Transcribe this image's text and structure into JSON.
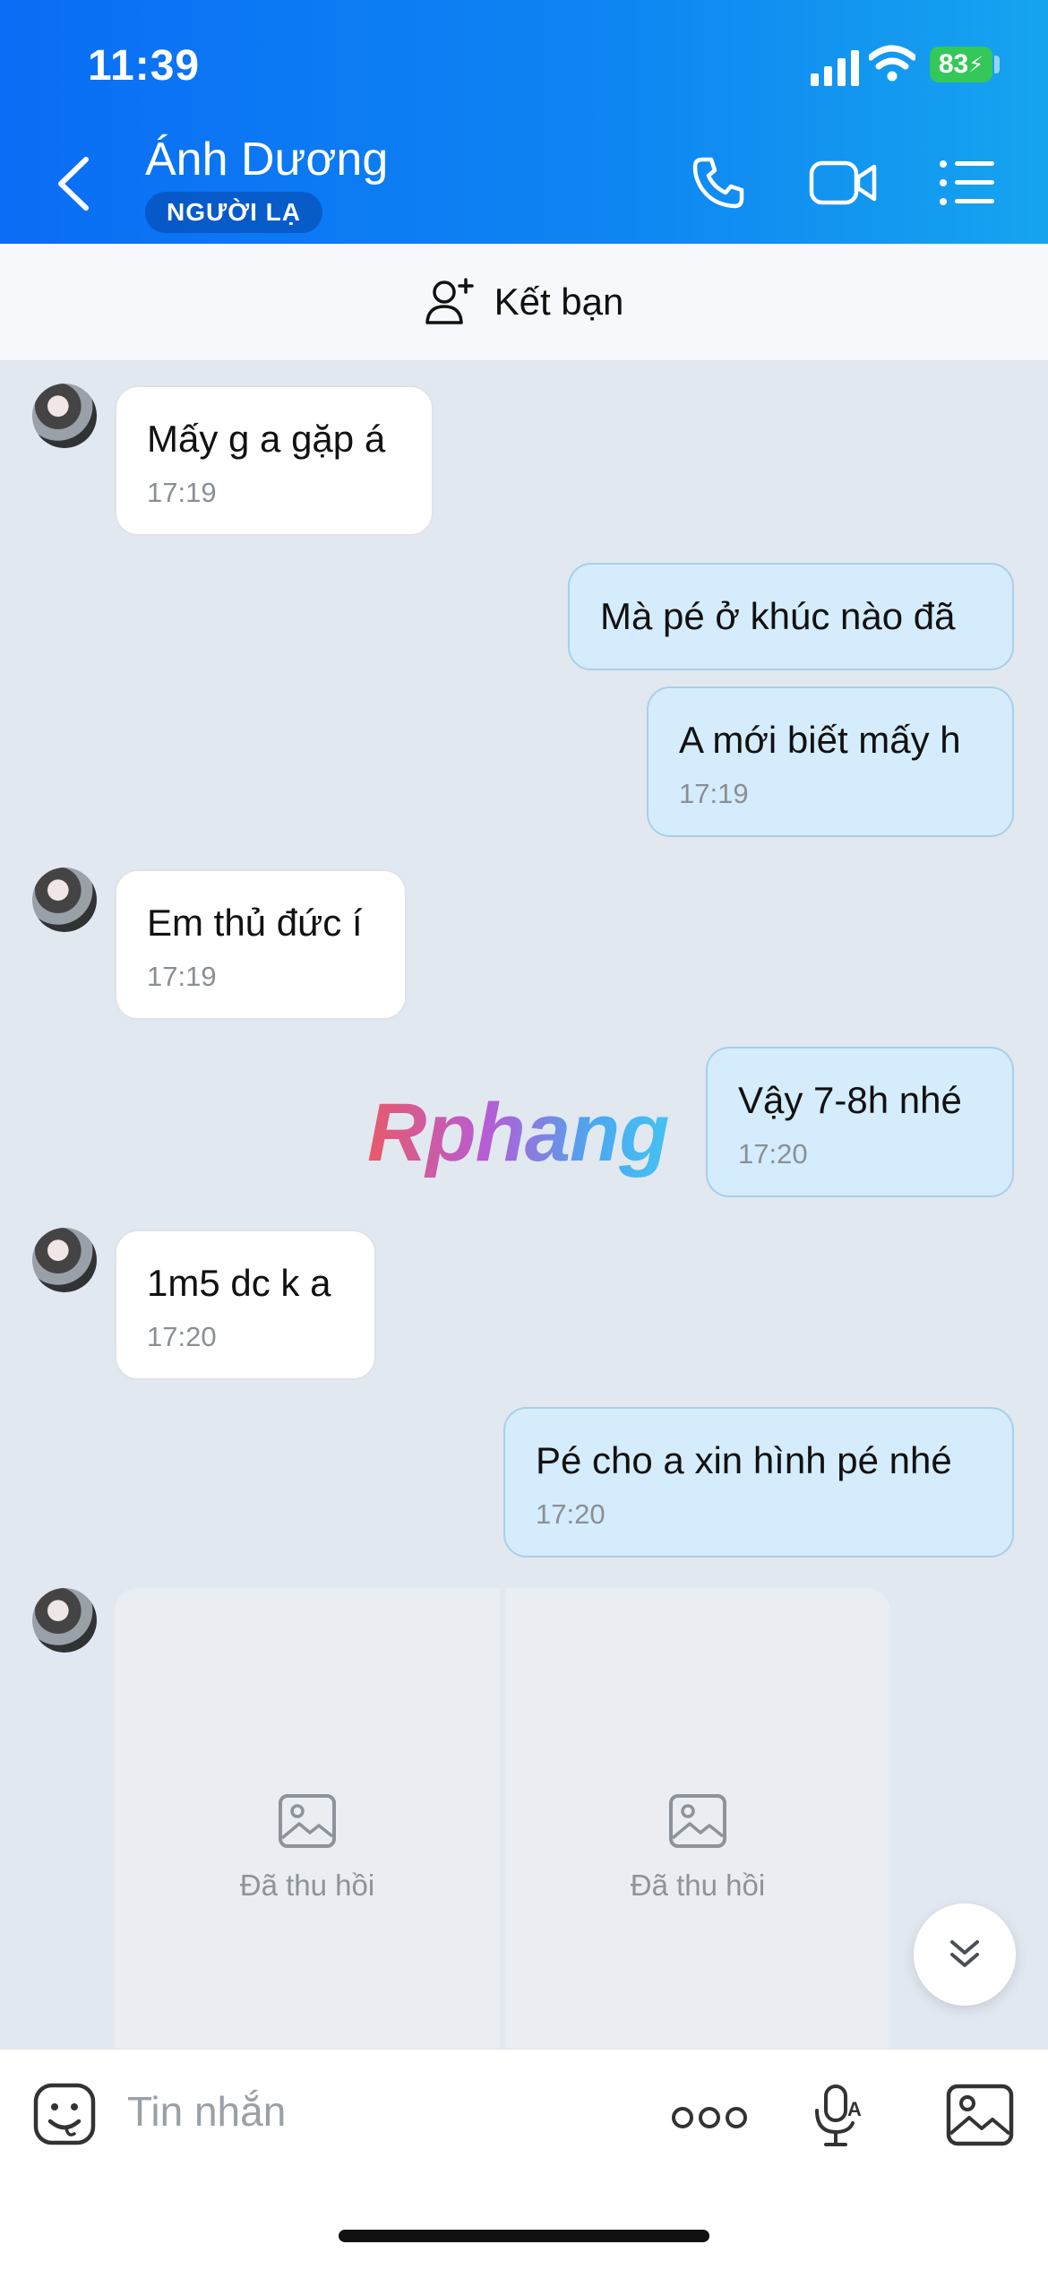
{
  "status_bar": {
    "time": "11:39",
    "battery": "83"
  },
  "header": {
    "contact_name": "Ánh Dương",
    "badge": "NGƯỜI LẠ"
  },
  "add_friend": {
    "label": "Kết bạn"
  },
  "messages": [
    {
      "side": "in",
      "text": "Mấy g a gặp á",
      "time": "17:19"
    },
    {
      "side": "out",
      "text": "Mà pé ở khúc nào đã",
      "time": ""
    },
    {
      "side": "out",
      "text": "A mới biết mấy h",
      "time": "17:19"
    },
    {
      "side": "in",
      "text": "Em thủ đức í",
      "time": "17:19"
    },
    {
      "side": "out",
      "text": "Vậy 7-8h nhé",
      "time": "17:20"
    },
    {
      "side": "in",
      "text": "1m5 dc k a",
      "time": "17:20"
    },
    {
      "side": "out",
      "text": "Pé cho a xin hình pé nhé",
      "time": "17:20"
    }
  ],
  "recalled_images": [
    {
      "label": "Đã thu hồi"
    },
    {
      "label": "Đã thu hồi"
    }
  ],
  "watermark": "Rphang",
  "input": {
    "placeholder": "Tin nhắn"
  },
  "icons": {
    "back": "chevron-left-icon",
    "call": "phone-icon",
    "video": "video-camera-icon",
    "menu": "list-menu-icon",
    "add_friend": "add-person-icon",
    "emoji": "emoji-icon",
    "more": "more-dots-icon",
    "voice": "microphone-icon",
    "image": "image-icon",
    "scroll_down": "double-chevron-down-icon"
  },
  "colors": {
    "header_start": "#0a6df5",
    "header_end": "#16a4ef",
    "outgoing_bubble": "#d4ecfc",
    "incoming_bubble": "#ffffff",
    "battery": "#34c759"
  }
}
